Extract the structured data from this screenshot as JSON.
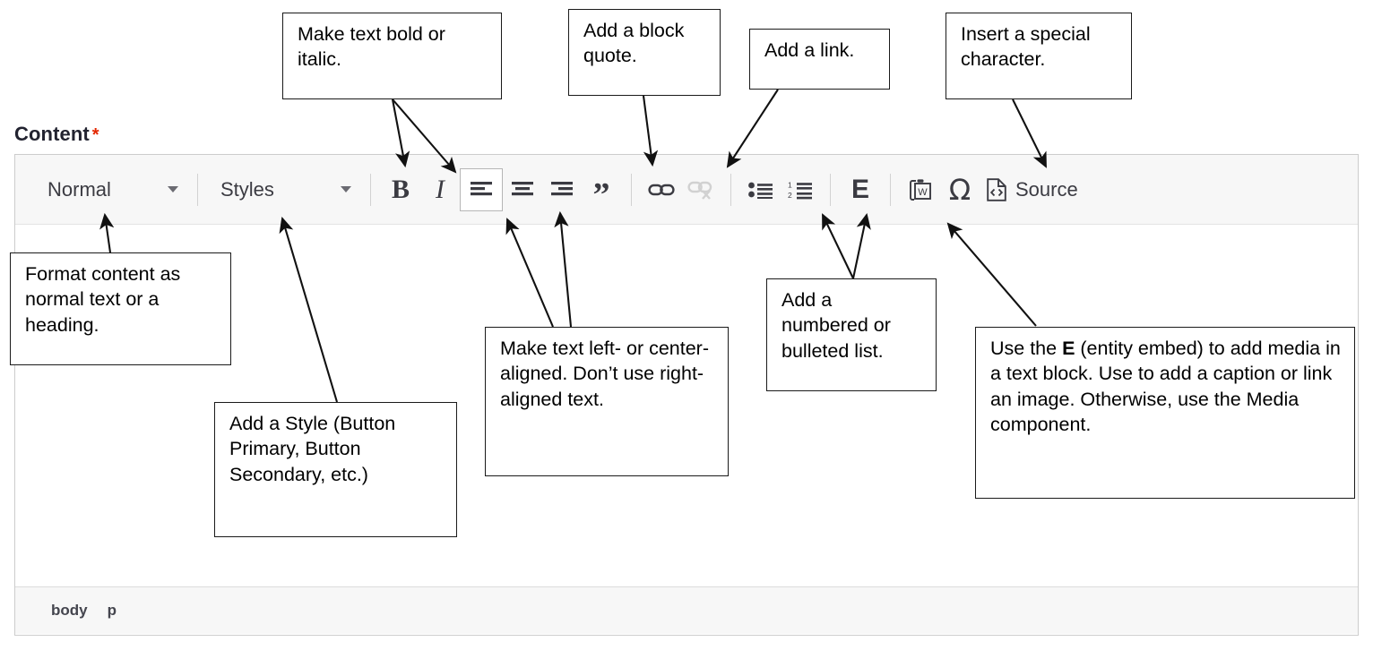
{
  "field": {
    "label": "Content",
    "required_mark": "*",
    "required_color": "#e32700"
  },
  "editor": {
    "toolbar": {
      "format_dropdown": {
        "name": "paragraph-format",
        "value": "Normal"
      },
      "styles_dropdown": {
        "name": "styles",
        "value": "Styles"
      },
      "buttons": [
        {
          "name": "bold",
          "glyph": "B",
          "state": "default"
        },
        {
          "name": "italic",
          "glyph": "I",
          "state": "default"
        },
        {
          "name": "align-left",
          "glyph": "align-left-icon",
          "state": "active"
        },
        {
          "name": "align-center",
          "glyph": "align-center-icon",
          "state": "default"
        },
        {
          "name": "align-right",
          "glyph": "align-right-icon",
          "state": "default"
        },
        {
          "name": "block-quote",
          "glyph": "”",
          "state": "default"
        },
        {
          "name": "link",
          "glyph": "link-icon",
          "state": "default"
        },
        {
          "name": "unlink",
          "glyph": "unlink-icon",
          "state": "disabled"
        },
        {
          "name": "bulleted-list",
          "glyph": "bulleted-list-icon",
          "state": "default"
        },
        {
          "name": "numbered-list",
          "glyph": "numbered-list-icon",
          "state": "default"
        },
        {
          "name": "entity-embed",
          "glyph": "E",
          "state": "default"
        },
        {
          "name": "paste-from-word",
          "glyph": "paste-from-word-icon",
          "state": "default"
        },
        {
          "name": "special-character",
          "glyph": "Ω",
          "state": "default"
        },
        {
          "name": "source",
          "glyph": "source-icon",
          "state": "default"
        }
      ],
      "source_label": "Source"
    },
    "body_text": "",
    "footer_breadcrumbs": [
      "body",
      "p"
    ]
  },
  "annotations": [
    {
      "id": "bold-italic",
      "text": "Make text bold or italic."
    },
    {
      "id": "block-quote",
      "text": "Add a block quote."
    },
    {
      "id": "link",
      "text": "Add a link."
    },
    {
      "id": "special-char",
      "text": "Insert a special character."
    },
    {
      "id": "format",
      "text": "Format content as normal text or a heading."
    },
    {
      "id": "style",
      "text": "Add a Style (Button Primary, Button Secondary, etc.)"
    },
    {
      "id": "align",
      "text": "Make text left- or center-aligned. Don’t use right-aligned text."
    },
    {
      "id": "list",
      "text": "Add a numbered or bulleted list."
    },
    {
      "id": "entity-embed-pre",
      "text": "Use the "
    },
    {
      "id": "entity-embed-bold",
      "text": "E"
    },
    {
      "id": "entity-embed-post",
      "text": " (entity embed) to add media in a text block. Use to add a caption or link an image. Otherwise, use the Media component."
    }
  ]
}
